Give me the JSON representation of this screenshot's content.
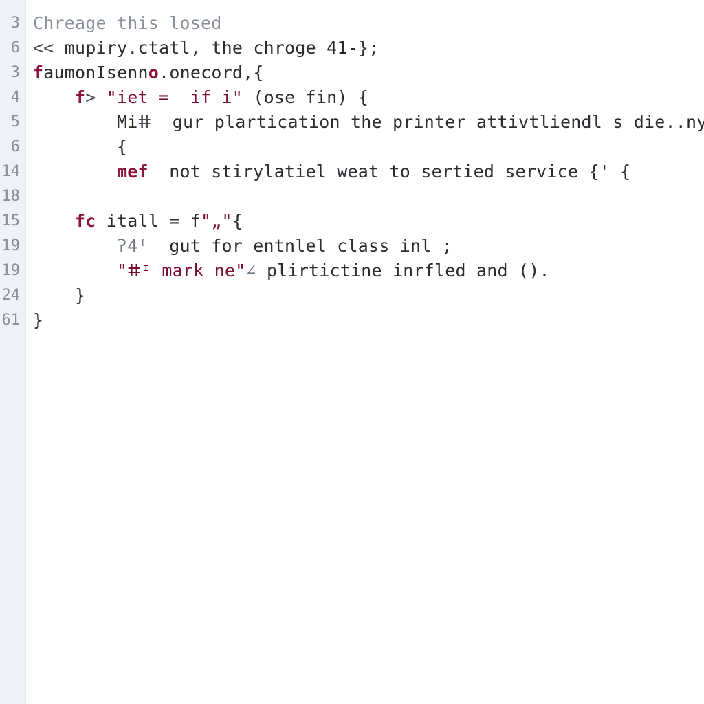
{
  "lines": [
    {
      "num": "3",
      "segments": [
        {
          "cls": "tk-comment",
          "text": "Chreage this losed"
        }
      ]
    },
    {
      "num": "6",
      "segments": [
        {
          "cls": "tk-op",
          "text": "<< "
        },
        {
          "cls": "tk-ident",
          "text": "mupiry"
        },
        {
          "cls": "tk-punct",
          "text": "."
        },
        {
          "cls": "tk-prop",
          "text": "ctatl"
        },
        {
          "cls": "tk-punct",
          "text": ", "
        },
        {
          "cls": "tk-ident",
          "text": "the chroge "
        },
        {
          "cls": "tk-num",
          "text": "41"
        },
        {
          "cls": "tk-punct",
          "text": "-};"
        }
      ]
    },
    {
      "num": "3",
      "segments": [
        {
          "cls": "tk-fn",
          "text": "f"
        },
        {
          "cls": "tk-ident",
          "text": "aumonIsenn"
        },
        {
          "cls": "tk-fn",
          "text": "o"
        },
        {
          "cls": "tk-punct",
          "text": "."
        },
        {
          "cls": "tk-prop",
          "text": "onecord"
        },
        {
          "cls": "tk-punct",
          "text": ","
        },
        {
          "cls": "tk-brace",
          "text": "{"
        }
      ]
    },
    {
      "num": "4",
      "segments": [
        {
          "cls": "tk-ident",
          "text": "    "
        },
        {
          "cls": "tk-kw",
          "text": "f"
        },
        {
          "cls": "tk-op",
          "text": "> "
        },
        {
          "cls": "tk-str",
          "text": "\"iet =  if i\""
        },
        {
          "cls": "tk-ident",
          "text": " (ose fin) "
        },
        {
          "cls": "tk-brace",
          "text": "{"
        }
      ]
    },
    {
      "num": "5",
      "segments": [
        {
          "cls": "tk-ident",
          "text": "        Mi"
        },
        {
          "cls": "tk-op",
          "text": "ⵌ  "
        },
        {
          "cls": "tk-ident",
          "text": "gur plartication the printer attivtliendl s die..ny"
        }
      ]
    },
    {
      "num": "6",
      "segments": [
        {
          "cls": "tk-ident",
          "text": "        "
        },
        {
          "cls": "tk-brace",
          "text": "{"
        }
      ]
    },
    {
      "num": "14",
      "segments": [
        {
          "cls": "tk-ident",
          "text": "        "
        },
        {
          "cls": "tk-kw",
          "text": "mef"
        },
        {
          "cls": "tk-ident",
          "text": "  not stirylatiel weat to sertied service "
        },
        {
          "cls": "tk-brace",
          "text": "{' {"
        }
      ]
    },
    {
      "num": "18",
      "segments": [
        {
          "cls": "tk-ident",
          "text": " "
        }
      ]
    },
    {
      "num": "15",
      "segments": [
        {
          "cls": "tk-ident",
          "text": "    "
        },
        {
          "cls": "tk-kw",
          "text": "fc"
        },
        {
          "cls": "tk-ident",
          "text": " itall = f"
        },
        {
          "cls": "tk-str",
          "text": "\"„\""
        },
        {
          "cls": "tk-brace",
          "text": "{"
        }
      ]
    },
    {
      "num": "19",
      "segments": [
        {
          "cls": "tk-ident",
          "text": "        "
        },
        {
          "cls": "tk-dim",
          "text": "ʔ4ᶠ  "
        },
        {
          "cls": "tk-ident",
          "text": "gut for entnlel class inl ;"
        }
      ]
    },
    {
      "num": "19",
      "segments": [
        {
          "cls": "tk-ident",
          "text": "        "
        },
        {
          "cls": "tk-str",
          "text": "\"ⵌᶦ mark ne\""
        },
        {
          "cls": "tk-dim",
          "text": "∠ "
        },
        {
          "cls": "tk-ident",
          "text": "plirtictine inrfled and ()."
        }
      ]
    },
    {
      "num": "24",
      "segments": [
        {
          "cls": "tk-ident",
          "text": "    "
        },
        {
          "cls": "tk-brace",
          "text": "}"
        }
      ]
    },
    {
      "num": "61",
      "segments": [
        {
          "cls": "tk-brace",
          "text": "}"
        }
      ]
    }
  ]
}
